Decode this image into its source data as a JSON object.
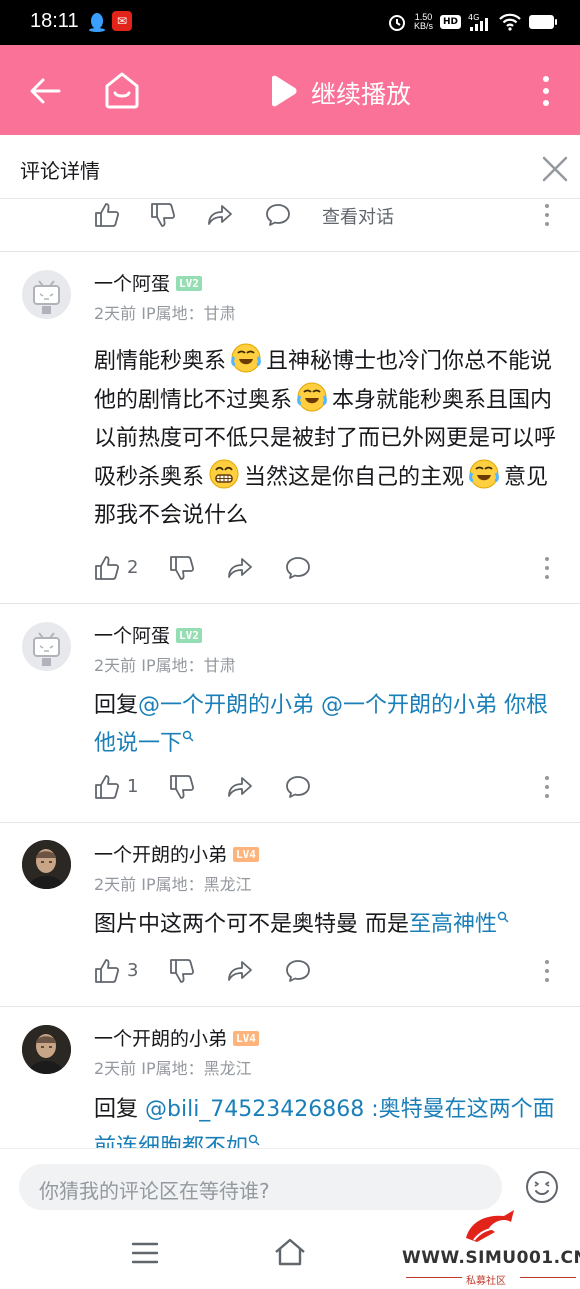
{
  "status_bar": {
    "time": "18:11",
    "speed_value": "1.50",
    "speed_unit": "KB/s",
    "hd": "HD",
    "network": "4G"
  },
  "top_bar": {
    "continue_play": "继续播放"
  },
  "detail_header": {
    "title": "评论详情"
  },
  "root_actions": {
    "view_conversation": "查看对话"
  },
  "comments": [
    {
      "username": "一个阿蛋",
      "level": "LV2",
      "meta": "2天前 IP属地：甘肃",
      "content_parts": [
        "剧情能秒奥系",
        "且神秘博士也冷门你总不能说他的剧情比不过奥系",
        "本身就能秒奥系且国内以前热度可不低只是被封了而已外网更是可以呼吸秒杀奥系",
        "当然这是你自己的主观",
        "意见那我不会说什么"
      ],
      "likes": "2"
    },
    {
      "username": "一个阿蛋",
      "level": "LV2",
      "meta": "2天前 IP属地：甘肃",
      "reply_prefix": "回复",
      "mention1": "@一个开朗的小弟",
      "mention2": "@一个开朗的小弟 你根他说一下",
      "likes": "1"
    },
    {
      "username": "一个开朗的小弟",
      "level": "LV4",
      "meta": "2天前 IP属地：黑龙江",
      "content_text": "图片中这两个可不是奥特曼 而是",
      "content_link": "至高神性",
      "likes": "3"
    },
    {
      "username": "一个开朗的小弟",
      "level": "LV4",
      "meta": "2天前 IP属地：黑龙江",
      "reply_prefix": "回复 ",
      "mention": "@bili_74523426868",
      "content_link": " :奥特曼在这两个面前连细胞都不如"
    }
  ],
  "input": {
    "placeholder": "你猜我的评论区在等待谁?"
  },
  "watermark": {
    "text": "WWW.SIMU001.CN",
    "sub": "私募社区"
  },
  "colors": {
    "brand_pink": "#fb7299",
    "link_blue": "#1a7fb8",
    "level2": "#95ddb2",
    "level4": "#ffb37c"
  }
}
